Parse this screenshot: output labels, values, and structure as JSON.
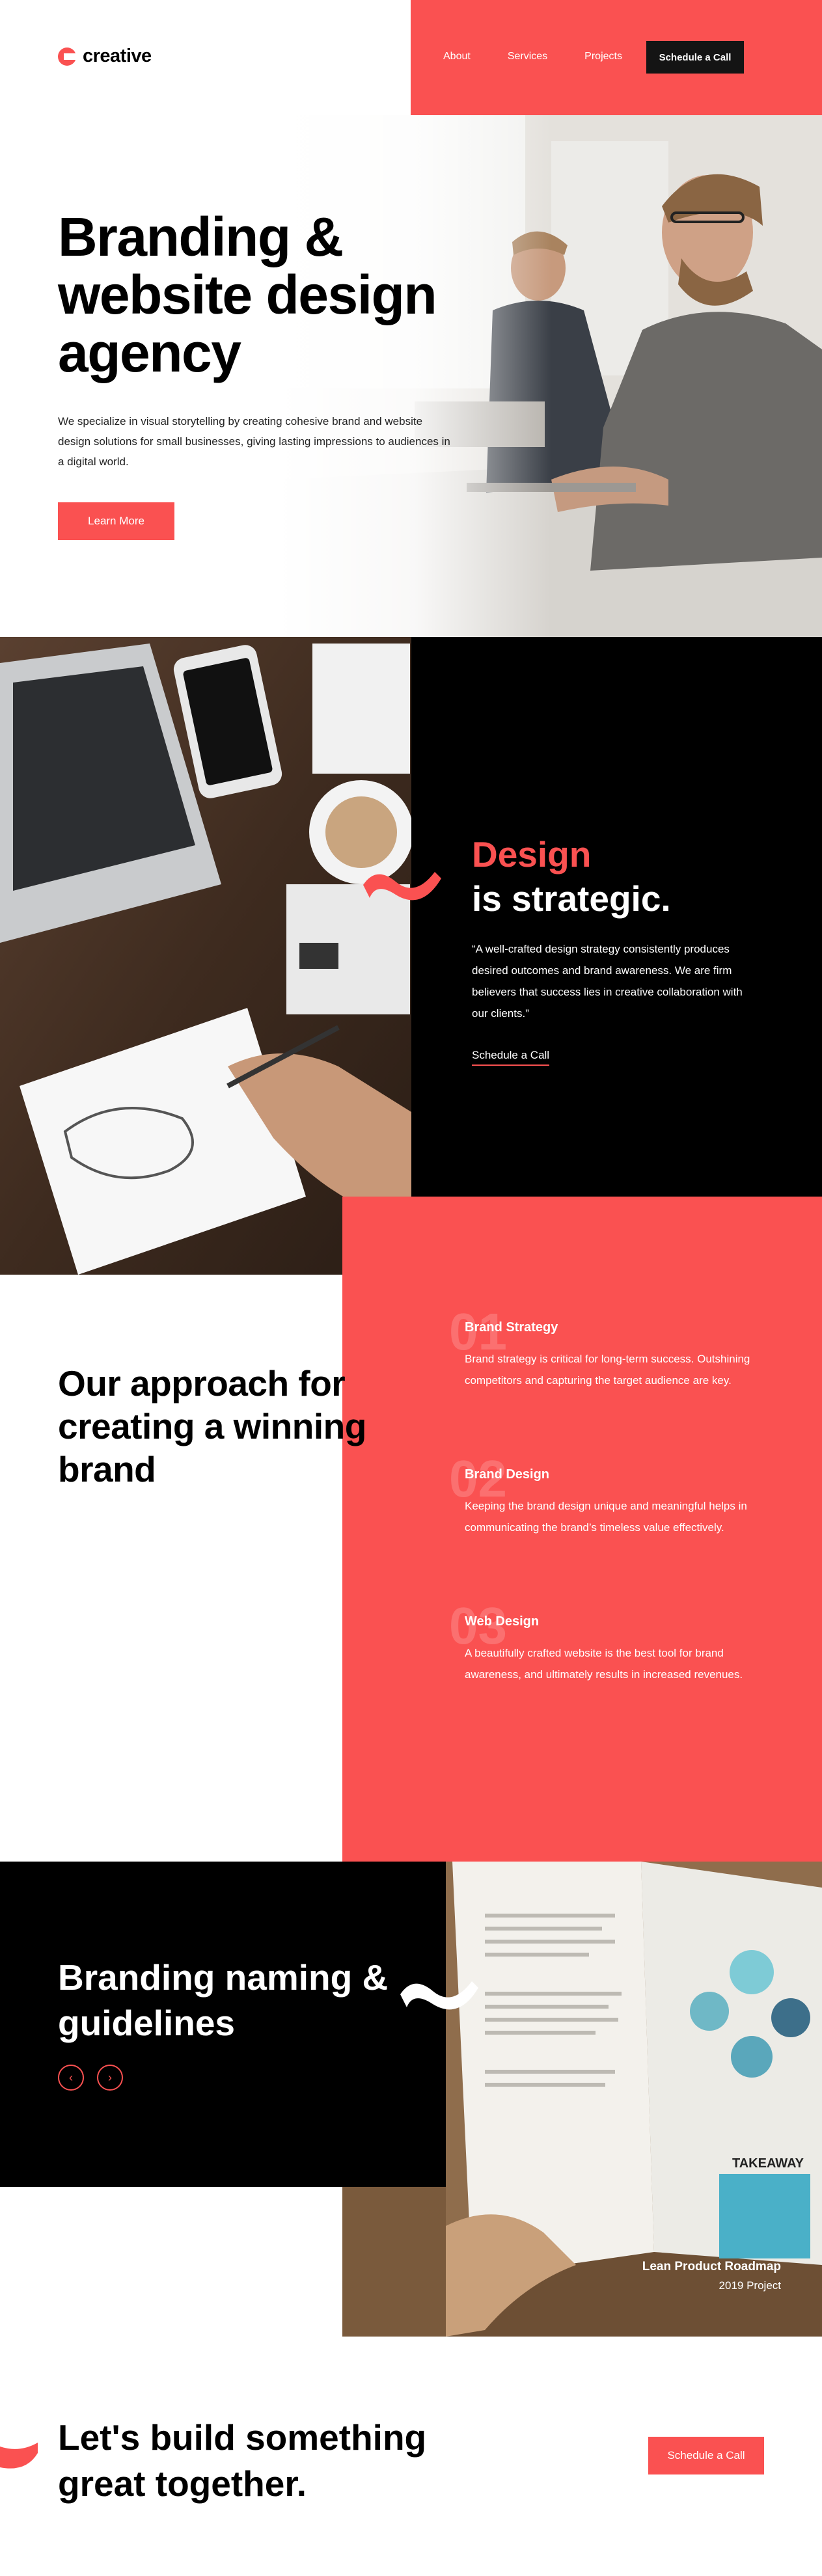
{
  "header": {
    "logo_text": "creative",
    "nav": [
      "About",
      "Services",
      "Projects"
    ],
    "cta_label": "Schedule a Call"
  },
  "hero": {
    "title": "Branding & website design agency",
    "description": "We specialize in visual storytelling by creating cohesive brand and website design solutions for small businesses, giving lasting impressions to audiences in a digital world.",
    "button_label": "Learn More"
  },
  "strategy": {
    "title_accent": "Design",
    "title_rest": "is strategic.",
    "quote": "“A well-crafted design strategy consistently produces desired outcomes and brand awareness. We are firm believers that success lies in creative collaboration with our clients.”",
    "link_label": "Schedule a Call"
  },
  "approach": {
    "title": "Our approach for creating a winning brand",
    "steps": [
      {
        "number": "01",
        "title": "Brand Strategy",
        "text": "Brand strategy is critical for long-term success. Outshining competitors and capturing the target audience are key."
      },
      {
        "number": "02",
        "title": "Brand Design",
        "text": "Keeping the brand design unique and meaningful helps in communicating the brand’s timeless value effectively."
      },
      {
        "number": "03",
        "title": "Web Design",
        "text": "A beautifully crafted website is the best tool for brand awareness, and ultimately results in increased revenues."
      }
    ]
  },
  "projects": {
    "title": "Branding naming & guidelines",
    "prev_icon": "chevron-left-icon",
    "next_icon": "chevron-right-icon",
    "project_title": "Lean Product Roadmap",
    "project_subtitle": "2019 Project",
    "book_text": "TAKEAWAY"
  },
  "cta": {
    "title": "Let's build something great together.",
    "button_label": "Schedule a Call"
  },
  "colors": {
    "accent": "#fa5151",
    "dark": "#000000",
    "button_dark": "#141414"
  }
}
